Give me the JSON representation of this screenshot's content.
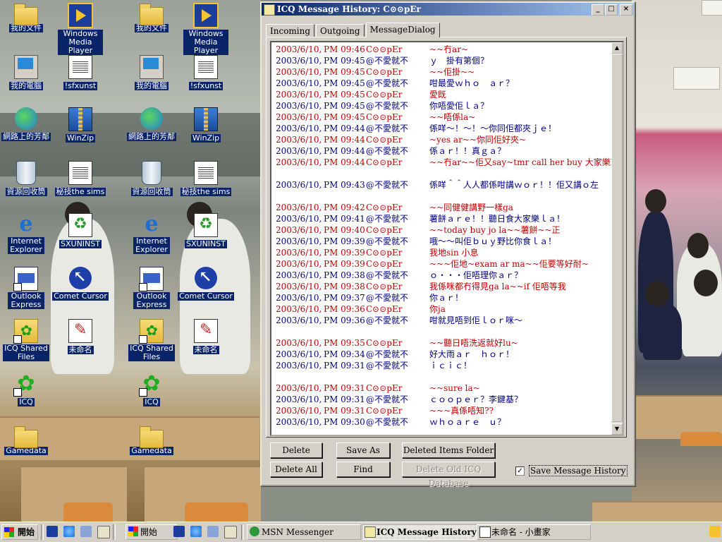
{
  "desktop": {
    "icons": [
      {
        "label": "我的文件"
      },
      {
        "label": "Windows Media Player"
      },
      {
        "label": "我的電腦"
      },
      {
        "label": "!sfxunst"
      },
      {
        "label": "網路上的芳鄰"
      },
      {
        "label": "WinZip"
      },
      {
        "label": "資源回收筒"
      },
      {
        "label": "秘技the sims"
      },
      {
        "label": "Internet Explorer"
      },
      {
        "label": "SXUNINST"
      },
      {
        "label": "Outlook Express"
      },
      {
        "label": "Comet Cursor"
      },
      {
        "label": "ICQ Shared Files"
      },
      {
        "label": "未命名"
      },
      {
        "label": "ICQ"
      },
      {
        "label": "Gamedata"
      }
    ]
  },
  "window": {
    "title": "ICQ Message History: C⊙⊙pEr",
    "controls": {
      "minimize": "_",
      "maximize": "□",
      "close": "×"
    },
    "tabs": [
      {
        "label": "Incoming"
      },
      {
        "label": "Outgoing"
      },
      {
        "label": "MessageDialog"
      }
    ],
    "active_tab": "MessageDialog",
    "messages": [
      {
        "date": "2003/6/10,",
        "time": "PM 09:46",
        "from": "C⊙⊙pEr",
        "text": "~~冇ar~",
        "dir": "in"
      },
      {
        "date": "2003/6/10,",
        "time": "PM 09:45",
        "from": "@不愛就不",
        "text": "ｙ　掛有第個？",
        "dir": "out"
      },
      {
        "date": "2003/6/10,",
        "time": "PM 09:45",
        "from": "C⊙⊙pEr",
        "text": "~~佢掛~~",
        "dir": "in"
      },
      {
        "date": "2003/6/10,",
        "time": "PM 09:45",
        "from": "@不愛就不",
        "text": "咁最愛ｗｈｏ　ａｒ？",
        "dir": "out"
      },
      {
        "date": "2003/6/10,",
        "time": "PM 09:45",
        "from": "C⊙⊙pEr",
        "text": "愛既",
        "dir": "in"
      },
      {
        "date": "2003/6/10,",
        "time": "PM 09:45",
        "from": "@不愛就不",
        "text": "你唔愛佢ｌａ？",
        "dir": "out"
      },
      {
        "date": "2003/6/10,",
        "time": "PM 09:45",
        "from": "C⊙⊙pEr",
        "text": "~~唔係la~",
        "dir": "in"
      },
      {
        "date": "2003/6/10,",
        "time": "PM 09:44",
        "from": "@不愛就不",
        "text": "係咩～！～！～你同佢都夾ｊｅ！",
        "dir": "out"
      },
      {
        "date": "2003/6/10,",
        "time": "PM 09:44",
        "from": "C⊙⊙pEr",
        "text": "~yes ar~~你同佢好夾~",
        "dir": "in"
      },
      {
        "date": "2003/6/10,",
        "time": "PM 09:44",
        "from": "@不愛就不",
        "text": "係ａｒ！！真ｇａ？",
        "dir": "out"
      },
      {
        "date": "2003/6/10,",
        "time": "PM 09:44",
        "from": "C⊙⊙pEr",
        "text": "~~冇ar~~佢又say~tmr call her buy 大家樂law~",
        "dir": "in"
      },
      {
        "blank": true
      },
      {
        "date": "2003/6/10,",
        "time": "PM 09:43",
        "from": "@不愛就不",
        "text": "係咩＾＾人人都係咁講ｗｏｒ！！佢又講ｏ左",
        "dir": "out"
      },
      {
        "blank": true
      },
      {
        "date": "2003/6/10,",
        "time": "PM 09:42",
        "from": "C⊙⊙pEr",
        "text": "~~同健健講野一樣ga",
        "dir": "in"
      },
      {
        "date": "2003/6/10,",
        "time": "PM 09:41",
        "from": "@不愛就不",
        "text": "薯餅ａｒｅ！！聽日食大家樂ｌａ！",
        "dir": "out"
      },
      {
        "date": "2003/6/10,",
        "time": "PM 09:40",
        "from": "C⊙⊙pEr",
        "text": "~~today buy jo la~~薯餅~~正",
        "dir": "in"
      },
      {
        "date": "2003/6/10,",
        "time": "PM 09:39",
        "from": "@不愛就不",
        "text": "哦～～叫佢ｂｕｙ野比你食ｌａ！",
        "dir": "out"
      },
      {
        "date": "2003/6/10,",
        "time": "PM 09:39",
        "from": "C⊙⊙pEr",
        "text": "我地sin 小息",
        "dir": "in"
      },
      {
        "date": "2003/6/10,",
        "time": "PM 09:39",
        "from": "C⊙⊙pEr",
        "text": "~~~佢地~exam ar ma~~佢要等好耐~",
        "dir": "in"
      },
      {
        "date": "2003/6/10,",
        "time": "PM 09:38",
        "from": "@不愛就不",
        "text": "ｏ・・・佢唔理你ａｒ？",
        "dir": "out"
      },
      {
        "date": "2003/6/10,",
        "time": "PM 09:38",
        "from": "C⊙⊙pEr",
        "text": "我係咪都冇得見ga la~~if 佢唔等我",
        "dir": "in"
      },
      {
        "date": "2003/6/10,",
        "time": "PM 09:37",
        "from": "@不愛就不",
        "text": "你ａｒ！",
        "dir": "out"
      },
      {
        "date": "2003/6/10,",
        "time": "PM 09:36",
        "from": "C⊙⊙pEr",
        "text": "你ja",
        "dir": "in"
      },
      {
        "date": "2003/6/10,",
        "time": "PM 09:36",
        "from": "@不愛就不",
        "text": "咁就見唔到佢ｌｏｒ咪～",
        "dir": "out"
      },
      {
        "blank": true
      },
      {
        "date": "2003/6/10,",
        "time": "PM 09:35",
        "from": "C⊙⊙pEr",
        "text": "~~聽日唔洗返就好lu~",
        "dir": "in"
      },
      {
        "date": "2003/6/10,",
        "time": "PM 09:34",
        "from": "@不愛就不",
        "text": "好大雨ａｒ　ｈｏｒ！",
        "dir": "out"
      },
      {
        "date": "2003/6/10,",
        "time": "PM 09:31",
        "from": "@不愛就不",
        "text": "ｉｃｉｃ！",
        "dir": "out"
      },
      {
        "blank": true
      },
      {
        "date": "2003/6/10,",
        "time": "PM 09:31",
        "from": "C⊙⊙pEr",
        "text": "~~sure la~",
        "dir": "in"
      },
      {
        "date": "2003/6/10,",
        "time": "PM 09:31",
        "from": "@不愛就不",
        "text": "ｃｏｏｐｅｒ？李鍵基？",
        "dir": "out"
      },
      {
        "date": "2003/6/10,",
        "time": "PM 09:31",
        "from": "C⊙⊙pEr",
        "text": "~~~真係唔知??",
        "dir": "in"
      },
      {
        "date": "2003/6/10,",
        "time": "PM 09:30",
        "from": "@不愛就不",
        "text": "ｗｈｏａｒｅ　ｕ？",
        "dir": "out"
      }
    ],
    "buttons": {
      "delete": "Delete",
      "save_as": "Save As",
      "deleted_items": "Deleted Items Folder",
      "delete_all": "Delete All",
      "find": "Find",
      "delete_old": "Delete Old ICQ Database"
    },
    "save_history": {
      "label": "Save Message History",
      "checked": true,
      "mark": "✓"
    }
  },
  "taskbar": {
    "start_label": "開始",
    "tasks": [
      {
        "label": "開始"
      },
      {
        "label": "MSN Messenger"
      },
      {
        "label": "ICQ Message History: C⊙⊙pEr"
      },
      {
        "label": "未命名 - 小畫家"
      }
    ]
  },
  "colors": {
    "incoming": "#c00000",
    "outgoing": "#000080",
    "titlebar": "#0a246a",
    "icon_label_bg": "#0a246a"
  }
}
